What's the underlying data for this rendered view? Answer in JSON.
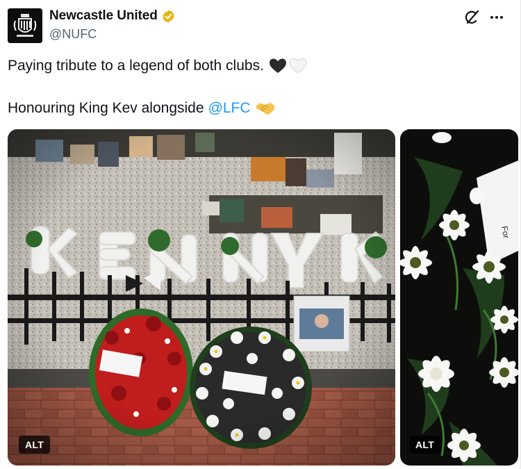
{
  "account": {
    "display_name": "Newcastle United",
    "handle": "@NUFC",
    "verified_badge": "gold-verified-badge-icon",
    "avatar": "club-crest-avatar"
  },
  "actions": {
    "grok_icon": "grok-icon",
    "more_icon": "more-options-icon"
  },
  "tweet": {
    "line1_text": "Paying tribute to a legend of both clubs.",
    "line1_emojis": [
      "black-heart",
      "white-heart"
    ],
    "line2_text": "Honouring King Kev alongside",
    "line2_mention": "@LFC",
    "line2_emoji": "handshake"
  },
  "media": [
    {
      "alt_label": "ALT",
      "subject": "floral-tributes-photo"
    },
    {
      "alt_label": "ALT",
      "subject": "white-flowers-closeup-photo"
    }
  ],
  "colors": {
    "text": "#0f1419",
    "secondary": "#536471",
    "link": "#1d9bf0",
    "verified_gold": "#e2b719"
  }
}
